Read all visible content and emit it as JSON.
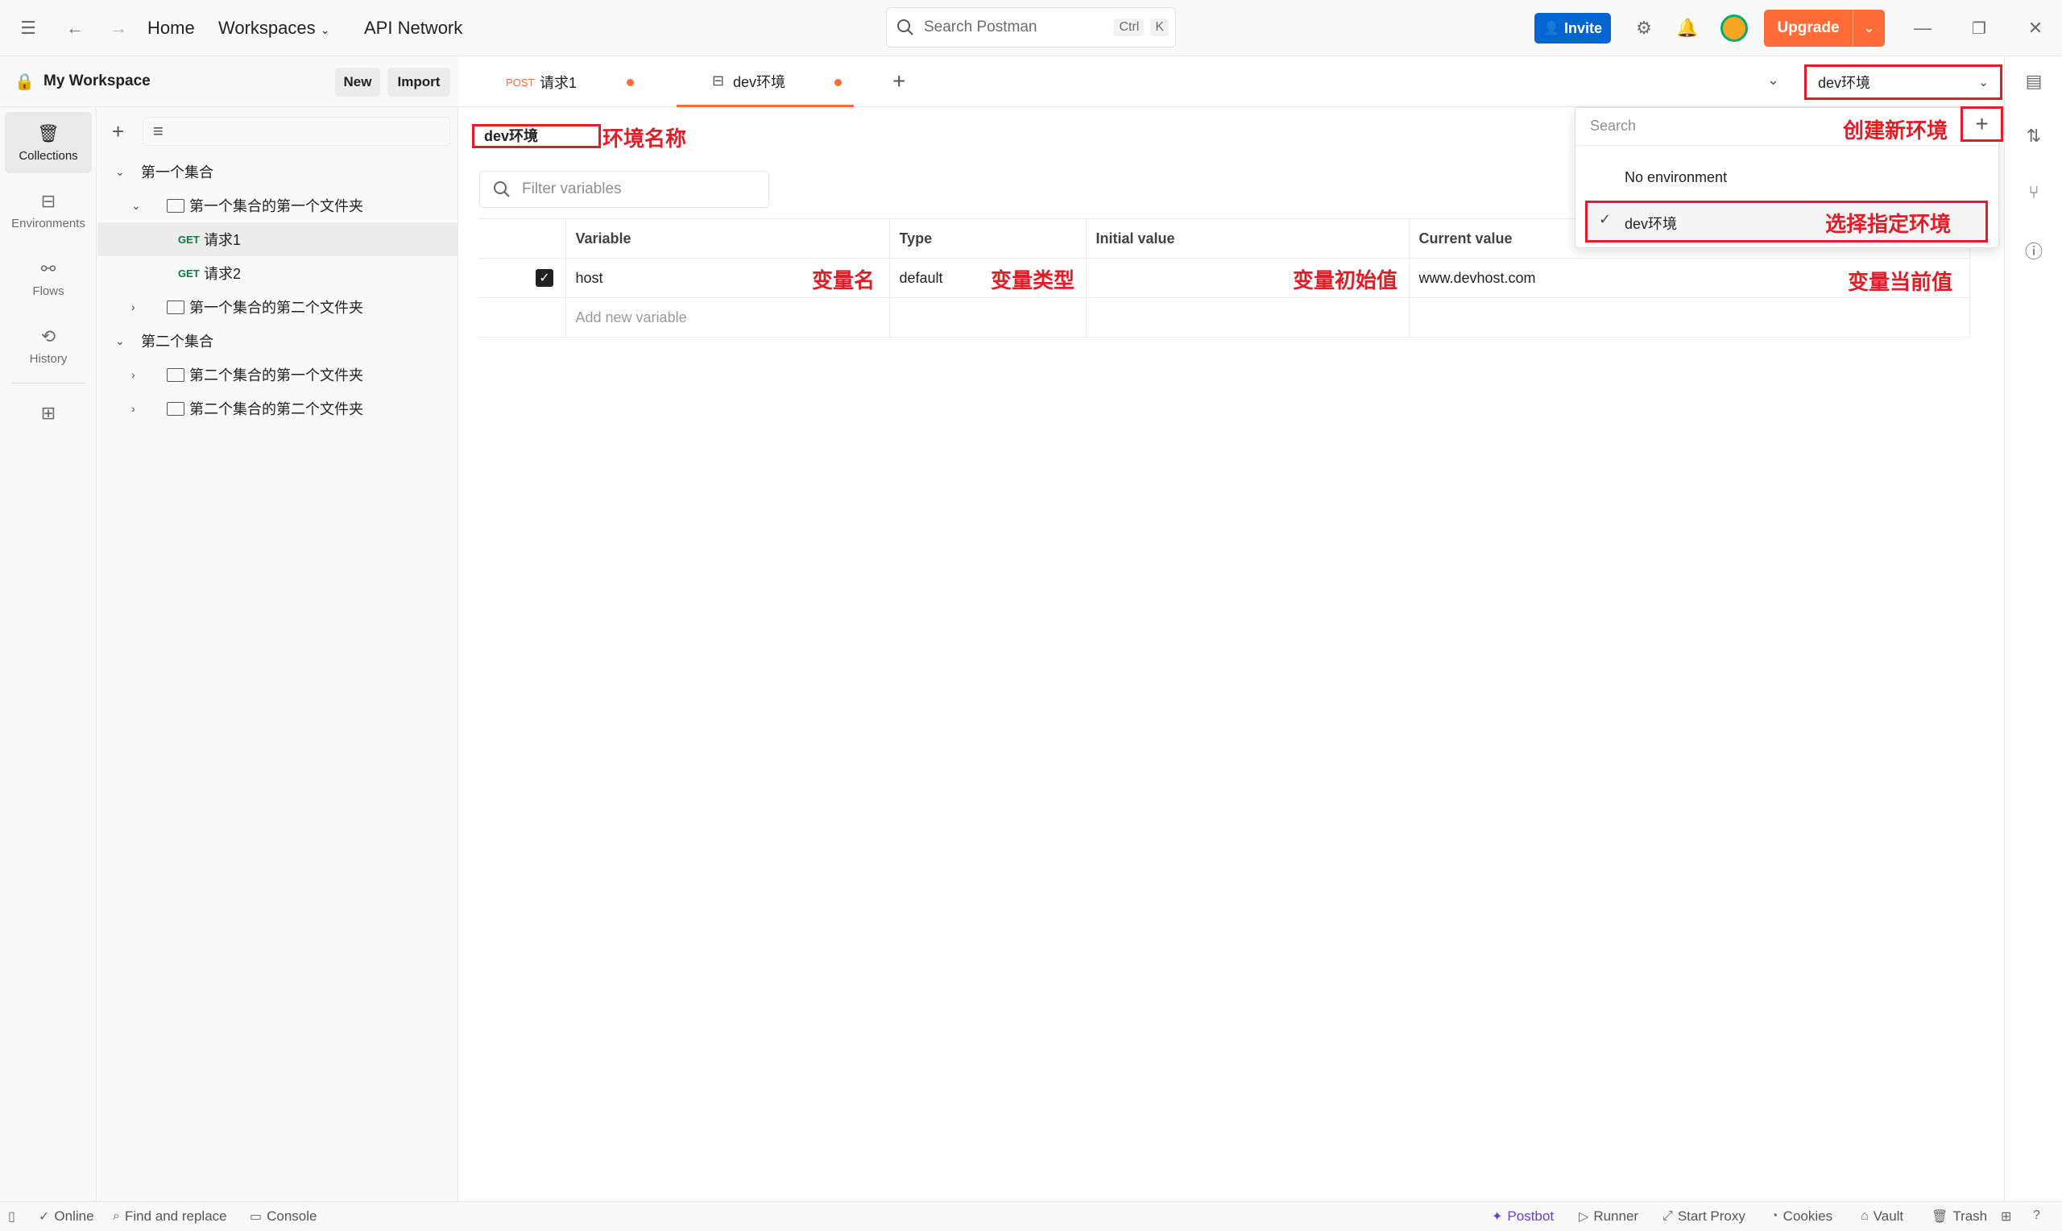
{
  "topbar": {
    "nav": {
      "home": "Home",
      "workspaces": "Workspaces",
      "api_network": "API Network"
    },
    "search": {
      "placeholder": "Search Postman",
      "shortcut_ctrl": "Ctrl",
      "shortcut_key": "K"
    },
    "invite_label": "Invite",
    "upgrade_label": "Upgrade"
  },
  "leftrail": {
    "items": [
      {
        "label": "Collections",
        "icon": "trash-can-like-collections-icon"
      },
      {
        "label": "Environments",
        "icon": "environment-icon"
      },
      {
        "label": "Flows",
        "icon": "flows-icon"
      },
      {
        "label": "History",
        "icon": "history-icon"
      }
    ]
  },
  "workspace": {
    "title": "My Workspace",
    "new_label": "New",
    "import_label": "Import"
  },
  "tree": [
    {
      "label": "第一个集合"
    },
    {
      "label": "第一个集合的第一个文件夹"
    },
    {
      "method": "GET",
      "label": "请求1"
    },
    {
      "method": "GET",
      "label": "请求2"
    },
    {
      "label": "第一个集合的第二个文件夹"
    },
    {
      "label": "第二个集合"
    },
    {
      "label": "第二个集合的第一个文件夹"
    },
    {
      "label": "第二个集合的第二个文件夹"
    }
  ],
  "tabs": [
    {
      "method": "POST",
      "label": "请求1"
    },
    {
      "label": "dev环境"
    }
  ],
  "env_selector": {
    "value": "dev环境"
  },
  "environment": {
    "name": "dev环境",
    "filter_placeholder": "Filter variables",
    "columns": [
      "Variable",
      "Type",
      "Initial value",
      "Current value"
    ],
    "rows": [
      {
        "variable": "host",
        "type": "default",
        "initial": "",
        "current": "www.devhost.com"
      }
    ],
    "add_placeholder": "Add new variable"
  },
  "dropdown": {
    "search_placeholder": "Search",
    "items": [
      "No environment",
      "dev环境"
    ]
  },
  "annotations": {
    "env_name": "环境名称",
    "create_env": "创建新环境",
    "select_env": "选择指定环境",
    "var_name": "变量名",
    "var_type": "变量类型",
    "var_initial": "变量初始值",
    "var_current": "变量当前值"
  },
  "statusbar": {
    "online": "Online",
    "find_replace": "Find and replace",
    "console": "Console",
    "postbot": "Postbot",
    "runner": "Runner",
    "start_proxy": "Start Proxy",
    "cookies": "Cookies",
    "vault": "Vault",
    "trash": "Trash"
  },
  "colors": {
    "accent": "#ff6c37",
    "invite_blue": "#0265d2",
    "annotation_red": "#e11d27",
    "get_green": "#0c7b3c",
    "post_orange": "#ff6c37"
  }
}
